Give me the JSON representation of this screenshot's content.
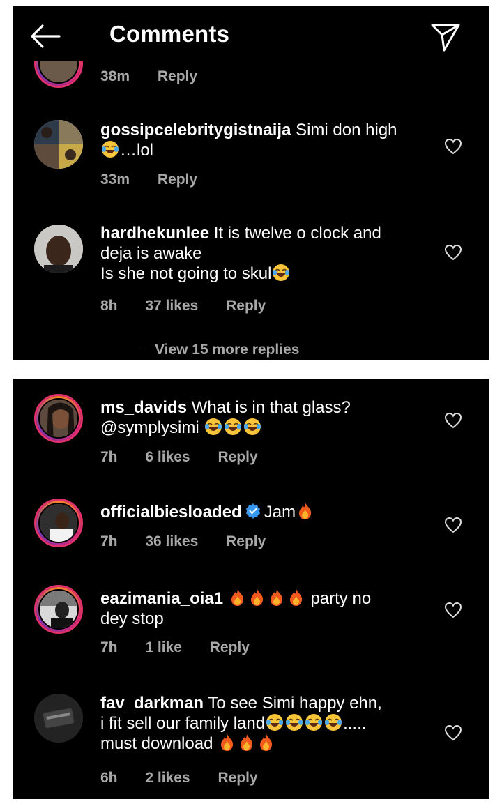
{
  "header": {
    "title": "Comments"
  },
  "partial_comment": {
    "time": "38m",
    "reply_label": "Reply"
  },
  "comments_top": [
    {
      "username": "gossipcelebritygistnaija",
      "lines": [
        "Simi don high",
        "…lol"
      ],
      "emoji_after_line": "laughing-tears",
      "time": "33m",
      "likes": "",
      "reply_label": "Reply"
    },
    {
      "username": "hardhekunlee",
      "lines": [
        "It is twelve o clock and",
        "deja is awake",
        "Is she not going to skul"
      ],
      "time": "8h",
      "likes": "37 likes",
      "reply_label": "Reply"
    }
  ],
  "view_more": "View 15 more replies",
  "comments_bottom": [
    {
      "username": "ms_davids",
      "lines": [
        "What is in that glass?",
        "@symplysimi"
      ],
      "time": "7h",
      "likes": "6 likes",
      "reply_label": "Reply"
    },
    {
      "username": "officialbiesloaded",
      "verified": true,
      "lines": [
        "Jam"
      ],
      "time": "7h",
      "likes": "36 likes",
      "reply_label": "Reply"
    },
    {
      "username": "eazimania_oia1",
      "lines": [
        "party no",
        "dey stop"
      ],
      "time": "7h",
      "likes": "1 like",
      "reply_label": "Reply"
    },
    {
      "username": "fav_darkman",
      "lines": [
        "To see Simi happy ehn,",
        "i fit sell our family land",
        ".....",
        "must download"
      ],
      "time": "6h",
      "likes": "2 likes",
      "reply_label": "Reply"
    }
  ],
  "colors": {
    "background": "#000000",
    "text": "#ffffff",
    "secondary": "#a8a8a8",
    "verified": "#3897f0",
    "story_ring": "#dd2a7b"
  },
  "icons": {
    "back": "back-arrow-icon",
    "send": "send-icon",
    "like": "heart-icon",
    "laugh": "laughing-tears-emoji",
    "fire": "fire-emoji",
    "verified": "verified-badge-icon"
  }
}
